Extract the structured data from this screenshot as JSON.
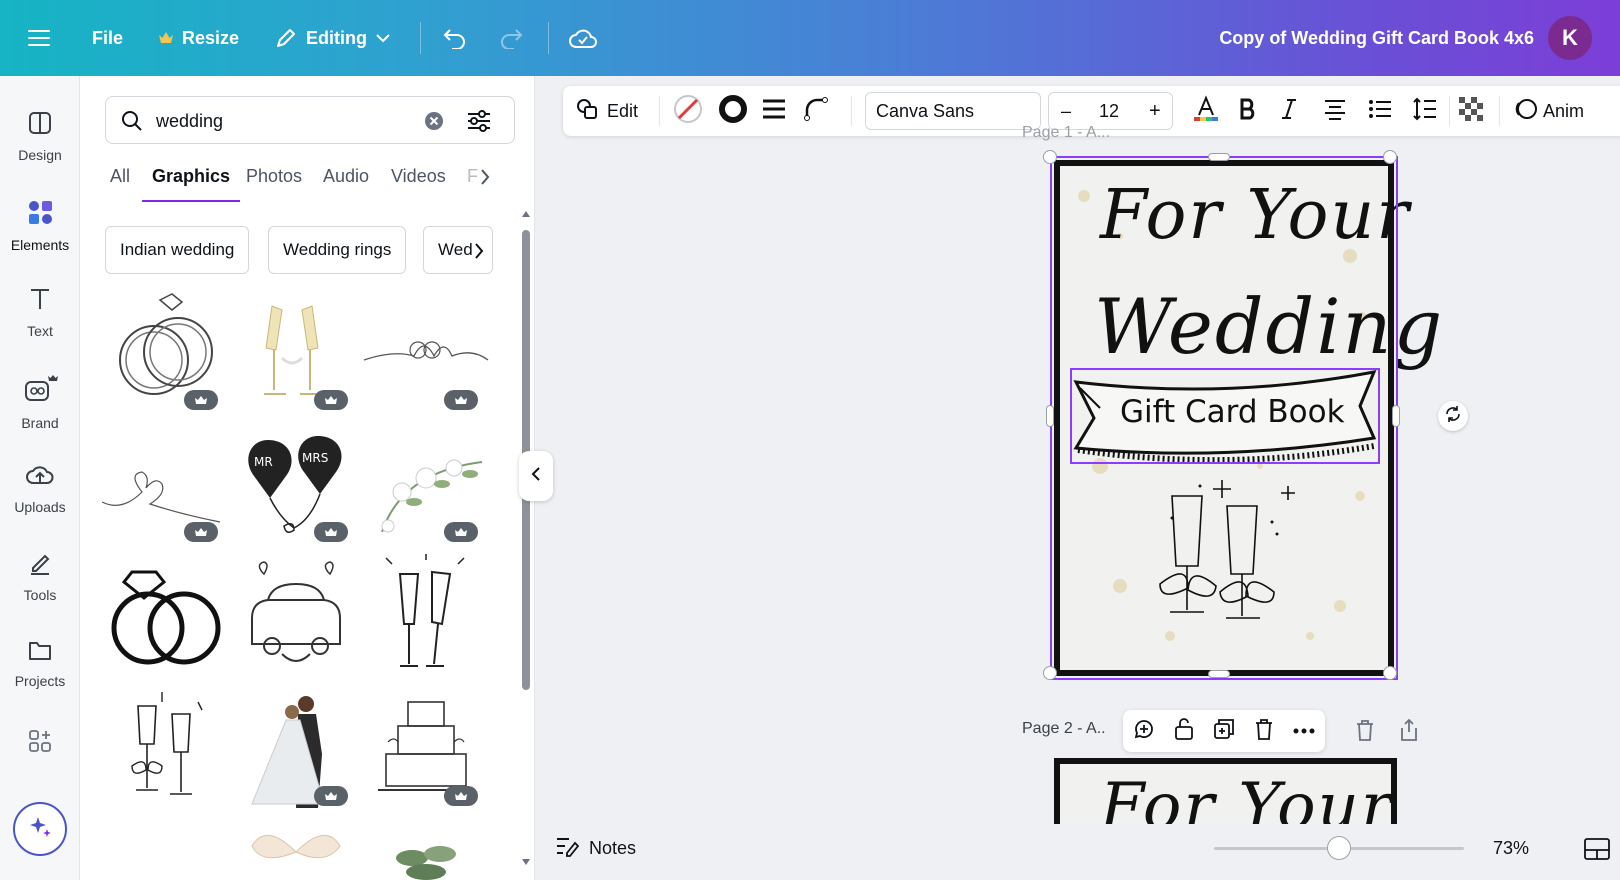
{
  "topbar": {
    "file": "File",
    "resize": "Resize",
    "editing": "Editing",
    "doc_title": "Copy of Wedding Gift Card Book 4x6",
    "avatar_letter": "K"
  },
  "rail": {
    "items": [
      {
        "label": "Design",
        "icon": "design-icon"
      },
      {
        "label": "Elements",
        "icon": "elements-icon"
      },
      {
        "label": "Text",
        "icon": "text-icon"
      },
      {
        "label": "Brand",
        "icon": "brand-icon"
      },
      {
        "label": "Uploads",
        "icon": "uploads-icon"
      },
      {
        "label": "Tools",
        "icon": "tools-icon"
      },
      {
        "label": "Projects",
        "icon": "projects-icon"
      }
    ]
  },
  "panel": {
    "search_value": "wedding",
    "tabs": [
      "All",
      "Graphics",
      "Photos",
      "Audio",
      "Videos",
      "F"
    ],
    "active_tab": "Graphics",
    "chips": [
      "Indian wedding",
      "Wedding rings",
      "Wed"
    ]
  },
  "toolbar": {
    "edit": "Edit",
    "font": "Canva Sans",
    "size": "12",
    "minus": "–",
    "plus": "+",
    "animate": "Anim"
  },
  "canvas": {
    "page1_label": "Page 1 - A...",
    "page2_label": "Page 2 - A..",
    "title_line1": "For Your",
    "title_line2": "Wedding",
    "banner": "Gift Card Book",
    "page2_title": "For Your"
  },
  "bottombar": {
    "notes": "Notes",
    "zoom": "73%",
    "zoom_fraction": 0.5
  },
  "colors": {
    "accent": "#8b3dff",
    "topbar_start": "#16b4c4",
    "topbar_end": "#7c3ed8"
  }
}
